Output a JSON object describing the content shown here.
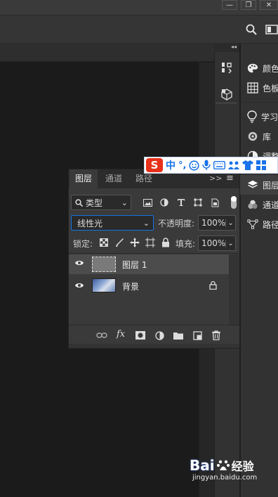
{
  "window": {
    "buttons": [
      {
        "name": "minimize",
        "glyph": "—"
      },
      {
        "name": "restore",
        "glyph": "❐"
      },
      {
        "name": "close",
        "glyph": "✕"
      }
    ]
  },
  "dock_collapse_glyph": "◂◂",
  "right_panel": {
    "items": [
      {
        "key": "color",
        "label": "颜色",
        "icon": "palette-icon"
      },
      {
        "key": "swatches",
        "label": "色板",
        "icon": "swatches-grid-icon"
      },
      {
        "key": "learn",
        "label": "学习",
        "icon": "lightbulb-icon"
      },
      {
        "key": "libraries",
        "label": "库",
        "icon": "cloud-libraries-icon"
      },
      {
        "key": "adjustments",
        "label": "调整",
        "icon": "adjustments-icon"
      },
      {
        "key": "layers",
        "label": "图层",
        "icon": "layers-icon",
        "active": true
      },
      {
        "key": "channels",
        "label": "通道",
        "icon": "channels-icon"
      },
      {
        "key": "paths",
        "label": "路径",
        "icon": "paths-icon"
      }
    ]
  },
  "layers_panel": {
    "tabs": [
      "图层",
      "通道",
      "路径"
    ],
    "active_tab": "图层",
    "menu_glyph": "≡",
    "collapse_glyph": ">>",
    "filter": {
      "label": "类型",
      "dropdown": "⌄"
    },
    "blend_mode": "线性光",
    "opacity_label": "不透明度:",
    "opacity_value": "100%",
    "lock_label": "锁定:",
    "fill_label": "填充:",
    "fill_value": "100%",
    "layers": [
      {
        "name": "图层 1",
        "selected": true,
        "locked": false
      },
      {
        "name": "背景",
        "selected": false,
        "locked": true
      }
    ]
  },
  "ime_toolbar": {
    "logo": "S",
    "mode": "中",
    "punct": "°,"
  },
  "watermark": {
    "logo": "Bai",
    "logo_suffix": "经验",
    "url": "jingyan.baidu.com"
  },
  "colors": {
    "accent_blue": "#1473e6",
    "sogou_red": "#e8311a",
    "ime_blue": "#1a73e8",
    "baidu_blue": "#2a5bd7"
  }
}
